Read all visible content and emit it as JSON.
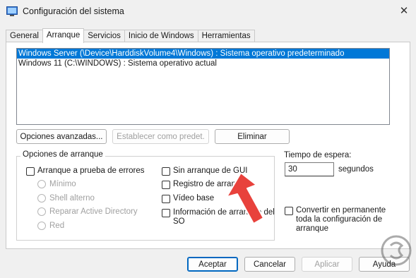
{
  "window": {
    "title": "Configuración del sistema",
    "close_glyph": "✕"
  },
  "tabs": [
    {
      "label": "General"
    },
    {
      "label": "Arranque"
    },
    {
      "label": "Servicios"
    },
    {
      "label": "Inicio de Windows"
    },
    {
      "label": "Herramientas"
    }
  ],
  "os_list": [
    "Windows Server (\\Device\\HarddiskVolume4\\Windows) : Sistema operativo predeterminado",
    "Windows 11 (C:\\WINDOWS) : Sistema operativo actual"
  ],
  "buttons": {
    "advanced": "Opciones avanzadas...",
    "set_default": "Establecer como predet.",
    "delete": "Eliminar",
    "ok": "Aceptar",
    "cancel": "Cancelar",
    "apply": "Aplicar",
    "help": "Ayuda"
  },
  "boot_options": {
    "title": "Opciones de arranque",
    "safe_boot": "Arranque a prueba de errores",
    "safe_modes": [
      "Mínimo",
      "Shell alterno",
      "Reparar Active Directory",
      "Red"
    ],
    "no_gui": "Sin arranque de GUI",
    "boot_log": "Registro de arranque",
    "base_video": "Vídeo base",
    "os_boot_info": "Información de arranque del SO"
  },
  "timeout": {
    "label": "Tiempo de espera:",
    "value": "30",
    "unit": "segundos"
  },
  "make_permanent": "Convertir en permanente toda la configuración de arranque",
  "colors": {
    "selection": "#0078d7",
    "accent": "#0067c0",
    "arrow": "#e8423c"
  }
}
